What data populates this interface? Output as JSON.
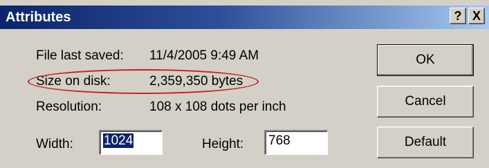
{
  "window": {
    "title": "Attributes",
    "help_label": "?",
    "close_label": "X"
  },
  "info": {
    "file_saved_label": "File last saved:",
    "file_saved_value": "11/4/2005 9:49 AM",
    "size_label": "Size on disk:",
    "size_value": "2,359,350 bytes",
    "resolution_label": "Resolution:",
    "resolution_value": "108 x 108 dots per inch"
  },
  "dimensions": {
    "width_label": "Width:",
    "width_value": "1024",
    "height_label": "Height:",
    "height_value": "768"
  },
  "buttons": {
    "ok": "OK",
    "cancel": "Cancel",
    "default": "Default"
  },
  "annotation": {
    "highlight_color": "#c81e1e"
  }
}
